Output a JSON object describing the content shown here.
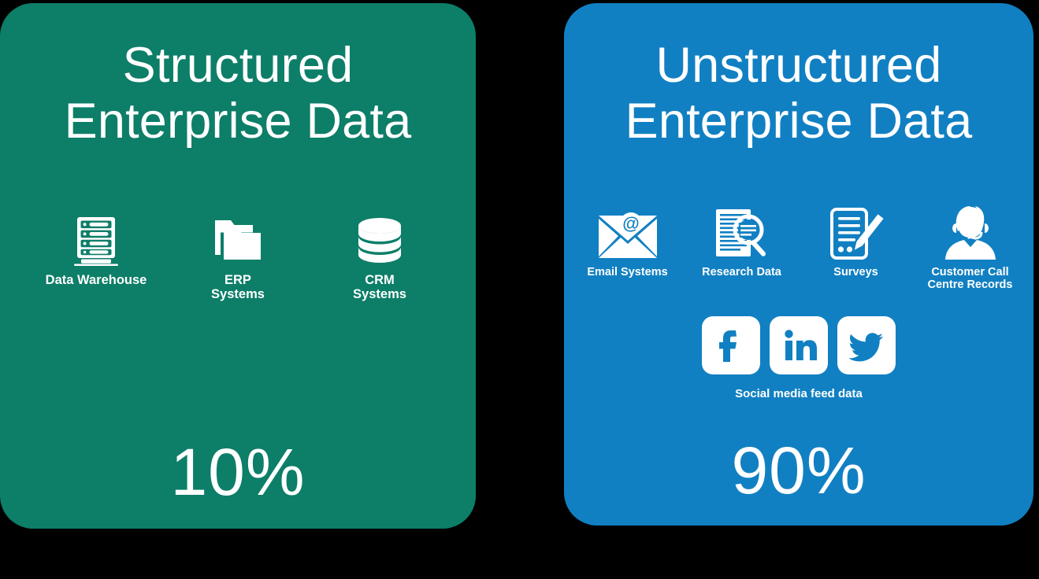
{
  "background_color": "#000000",
  "panels": [
    {
      "id": "structured",
      "title_line1": "Structured",
      "title_line2": "Enterprise Data",
      "percent": "10%",
      "background_color": "#0d7e68",
      "text_color": "#ffffff",
      "items": [
        {
          "label": "Data Warehouse",
          "icon": "server-rack-icon"
        },
        {
          "label": "ERP\nSystems",
          "icon": "folder-icon"
        },
        {
          "label": "CRM\nSystems",
          "icon": "database-icon"
        }
      ]
    },
    {
      "id": "unstructured",
      "title_line1": "Unstructured",
      "title_line2": "Enterprise Data",
      "percent": "90%",
      "background_color": "#1180c2",
      "text_color": "#ffffff",
      "items": [
        {
          "label": "Email Systems",
          "icon": "envelope-at-icon"
        },
        {
          "label": "Research Data",
          "icon": "document-magnifier-icon"
        },
        {
          "label": "Surveys",
          "icon": "clipboard-pencil-icon"
        },
        {
          "label": "Customer Call\nCentre Records",
          "icon": "headset-agent-icon"
        }
      ],
      "social": {
        "label": "Social media feed data",
        "tiles": [
          {
            "name": "facebook-icon",
            "glyph": "f"
          },
          {
            "name": "linkedin-icon",
            "glyph": "in"
          },
          {
            "name": "twitter-icon",
            "glyph": "bird"
          }
        ],
        "tile_background": "#ffffff",
        "glyph_color": "#1180c2"
      }
    }
  ]
}
